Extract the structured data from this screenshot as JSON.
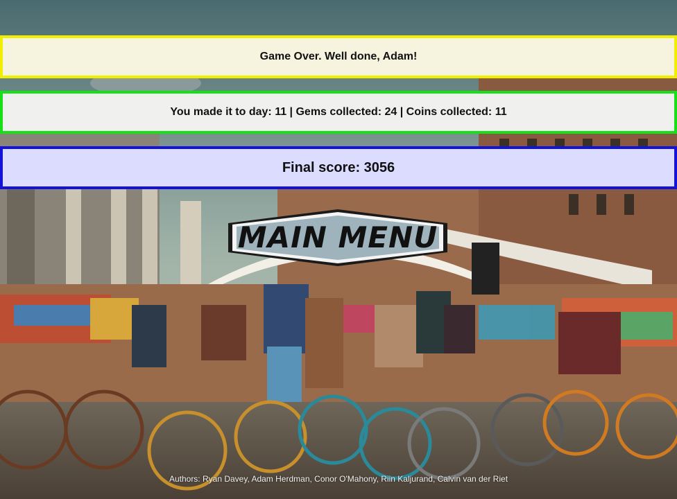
{
  "game_over_message": "Game Over. Well done, Adam!",
  "stats_message": "You made it to day: 11 | Gems collected: 24 | Coins collected: 11",
  "final_score_message": "Final score: 3056",
  "main_menu_label": "MAIN MENU",
  "authors": "Authors: Ryan Davey, Adam Herdman, Conor O'Mahony, Riin Kaljurand, Calvin van der Riet",
  "colors": {
    "banner1_border": "#f2ee00",
    "banner2_border": "#18e018",
    "banner3_border": "#1212d8",
    "button_fill": "#9fb3bd"
  }
}
